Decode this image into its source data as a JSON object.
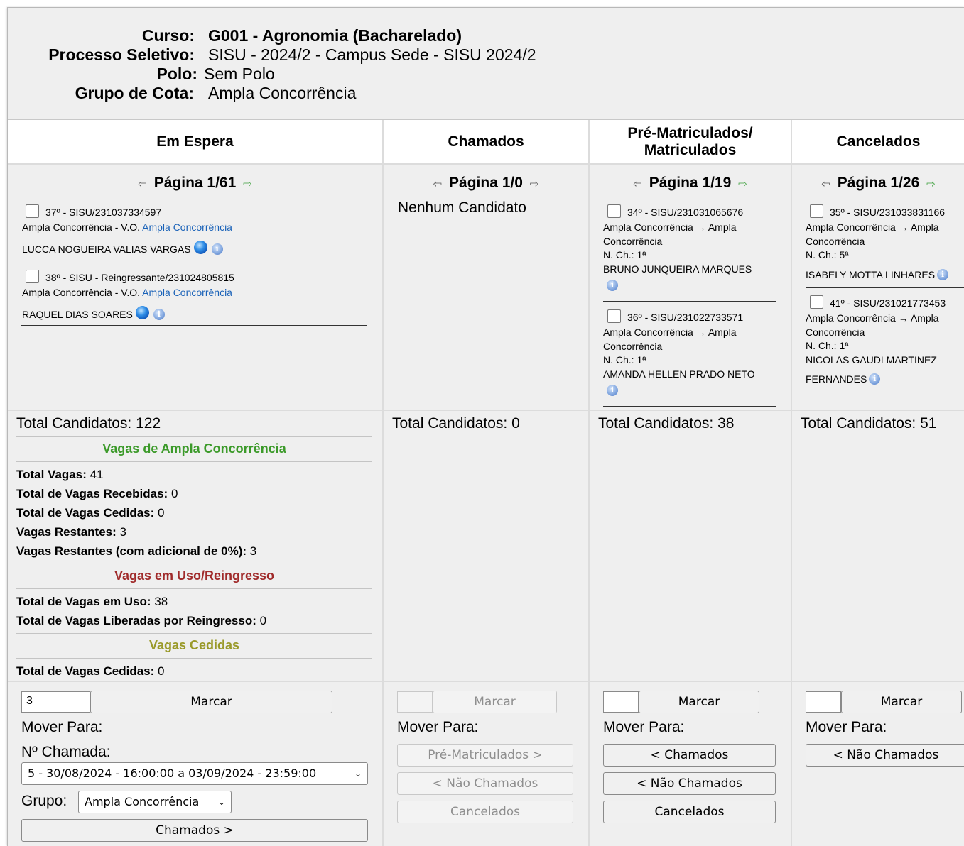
{
  "header": {
    "curso_label": "Curso:",
    "curso_value": "G001 - Agronomia (Bacharelado)",
    "processo_label": "Processo Seletivo:",
    "processo_value": "SISU - 2024/2 - Campus Sede - SISU 2024/2",
    "polo_label": "Polo:",
    "polo_value": "Sem Polo",
    "grupo_label": "Grupo de Cota:",
    "grupo_value": "Ampla Concorrência"
  },
  "icons": {
    "prev": "arrow-left-icon",
    "next": "arrow-right-icon",
    "info": "info-icon",
    "status": "blue-ball-icon"
  },
  "columns": [
    {
      "title": "Em Espera",
      "pager": "Página 1/61",
      "total": "Total Candidatos: 122",
      "items": [
        {
          "header": "37º - SISU/231037334597",
          "line2a": "Ampla Concorrência - V.O.",
          "line2b": "Ampla Concorrência",
          "name": "LUCCA NOGUEIRA VALIAS VARGAS"
        },
        {
          "header": "38º - SISU - Reingressante/231024805815",
          "line2a": "Ampla Concorrência - V.O.",
          "line2b": "Ampla Concorrência",
          "name": "RAQUEL DIAS SOARES"
        }
      ],
      "marcar_value": "3",
      "marcar_label": "Marcar",
      "mover_label": "Mover Para:",
      "chamada_label": "Nº Chamada:",
      "chamada_select": "5 - 30/08/2024 - 16:00:00 a 03/09/2024 - 23:59:00",
      "grupo_label": "Grupo:",
      "grupo_select": "Ampla Concorrência",
      "chamados_button": "Chamados >"
    },
    {
      "title": "Chamados",
      "pager": "Página 1/0",
      "empty": "Nenhum Candidato",
      "total": "Total Candidatos: 0",
      "marcar_label": "Marcar",
      "mover_label": "Mover Para:",
      "buttons": [
        "Pré-Matriculados >",
        "< Não Chamados",
        "Cancelados"
      ]
    },
    {
      "title_line1": "Pré-Matriculados/",
      "title_line2": "Matriculados",
      "pager": "Página 1/19",
      "total": "Total Candidatos: 38",
      "items": [
        {
          "header": "34º - SISU/231031065676",
          "lines": [
            "Ampla Concorrência → Ampla",
            "Concorrência",
            "N. Ch.: 1ª"
          ],
          "name": "BRUNO JUNQUEIRA MARQUES"
        },
        {
          "header": "36º - SISU/231022733571",
          "lines": [
            "Ampla Concorrência → Ampla",
            "Concorrência",
            "N. Ch.: 1ª"
          ],
          "name": "AMANDA HELLEN PRADO NETO"
        }
      ],
      "marcar_label": "Marcar",
      "mover_label": "Mover Para:",
      "buttons": [
        "< Chamados",
        "< Não Chamados",
        "Cancelados"
      ]
    },
    {
      "title": "Cancelados",
      "pager": "Página 1/26",
      "total": "Total Candidatos: 51",
      "items": [
        {
          "header": "35º - SISU/231033831166",
          "lines": [
            "Ampla Concorrência → Ampla",
            "Concorrência",
            "N. Ch.: 5ª"
          ],
          "name": "ISABELY MOTTA LINHARES"
        },
        {
          "header": "41º - SISU/231021773453",
          "lines": [
            "Ampla Concorrência → Ampla",
            "Concorrência",
            "N. Ch.: 1ª",
            "NICOLAS GAUDI MARTINEZ"
          ],
          "name": "FERNANDES"
        }
      ],
      "marcar_label": "Marcar",
      "mover_label": "Mover Para:",
      "buttons": [
        "< Não Chamados"
      ]
    }
  ],
  "stats": {
    "ampla_title": "Vagas de Ampla Concorrência",
    "ampla_color": "#3c9a2a",
    "total_vagas_label": "Total Vagas:",
    "total_vagas": "41",
    "recebidas_label": "Total de Vagas Recebidas:",
    "recebidas": "0",
    "cedidas_label": "Total de Vagas Cedidas:",
    "cedidas": "0",
    "restantes_label": "Vagas Restantes:",
    "restantes": "3",
    "restantes_adic_label": "Vagas Restantes (com adicional de 0%):",
    "restantes_adic": "3",
    "uso_title": "Vagas em Uso/Reingresso",
    "uso_color": "#a02b2b",
    "em_uso_label": "Total de Vagas em Uso:",
    "em_uso": "38",
    "liberadas_label": "Total de Vagas Liberadas por Reingresso:",
    "liberadas": "0",
    "cedidas_title": "Vagas Cedidas",
    "cedidas_color": "#9a9a2a",
    "total_cedidas_label": "Total de Vagas Cedidas:",
    "total_cedidas": "0"
  }
}
